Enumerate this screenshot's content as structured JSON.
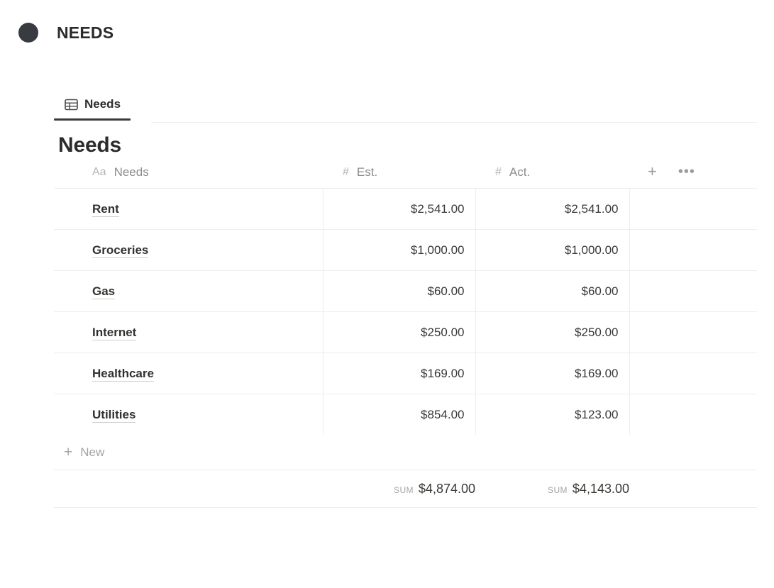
{
  "page": {
    "bullet_icon": "filled-circle-icon",
    "title": "NEEDS"
  },
  "view_tabs": [
    {
      "icon": "table-view-icon",
      "label": "Needs",
      "active": true
    }
  ],
  "database": {
    "title": "Needs",
    "columns": [
      {
        "type_icon": "text-type-icon",
        "type_glyph": "Aa",
        "name": "Needs"
      },
      {
        "type_icon": "number-type-icon",
        "type_glyph": "#",
        "name": "Est."
      },
      {
        "type_icon": "number-type-icon",
        "type_glyph": "#",
        "name": "Act."
      }
    ],
    "header_actions": {
      "add_column_icon": "plus-icon",
      "more_options_icon": "ellipsis-icon"
    },
    "rows": [
      {
        "name": "Rent",
        "est": "$2,541.00",
        "act": "$2,541.00"
      },
      {
        "name": "Groceries",
        "est": "$1,000.00",
        "act": "$1,000.00"
      },
      {
        "name": "Gas",
        "est": "$60.00",
        "act": "$60.00"
      },
      {
        "name": "Internet",
        "est": "$250.00",
        "act": "$250.00"
      },
      {
        "name": "Healthcare",
        "est": "$169.00",
        "act": "$169.00"
      },
      {
        "name": "Utilities",
        "est": "$854.00",
        "act": "$123.00"
      }
    ],
    "new_row": {
      "icon": "plus-icon",
      "label": "New"
    },
    "summary": [
      {
        "label": "SUM",
        "value": "$4,874.00"
      },
      {
        "label": "SUM",
        "value": "$4,143.00"
      }
    ]
  },
  "colors": {
    "bullet": "#383c41",
    "text_primary": "#37352f",
    "text_muted": "#9b9a97",
    "border": "#eeedec",
    "tab_underline": "#3b3a37"
  }
}
